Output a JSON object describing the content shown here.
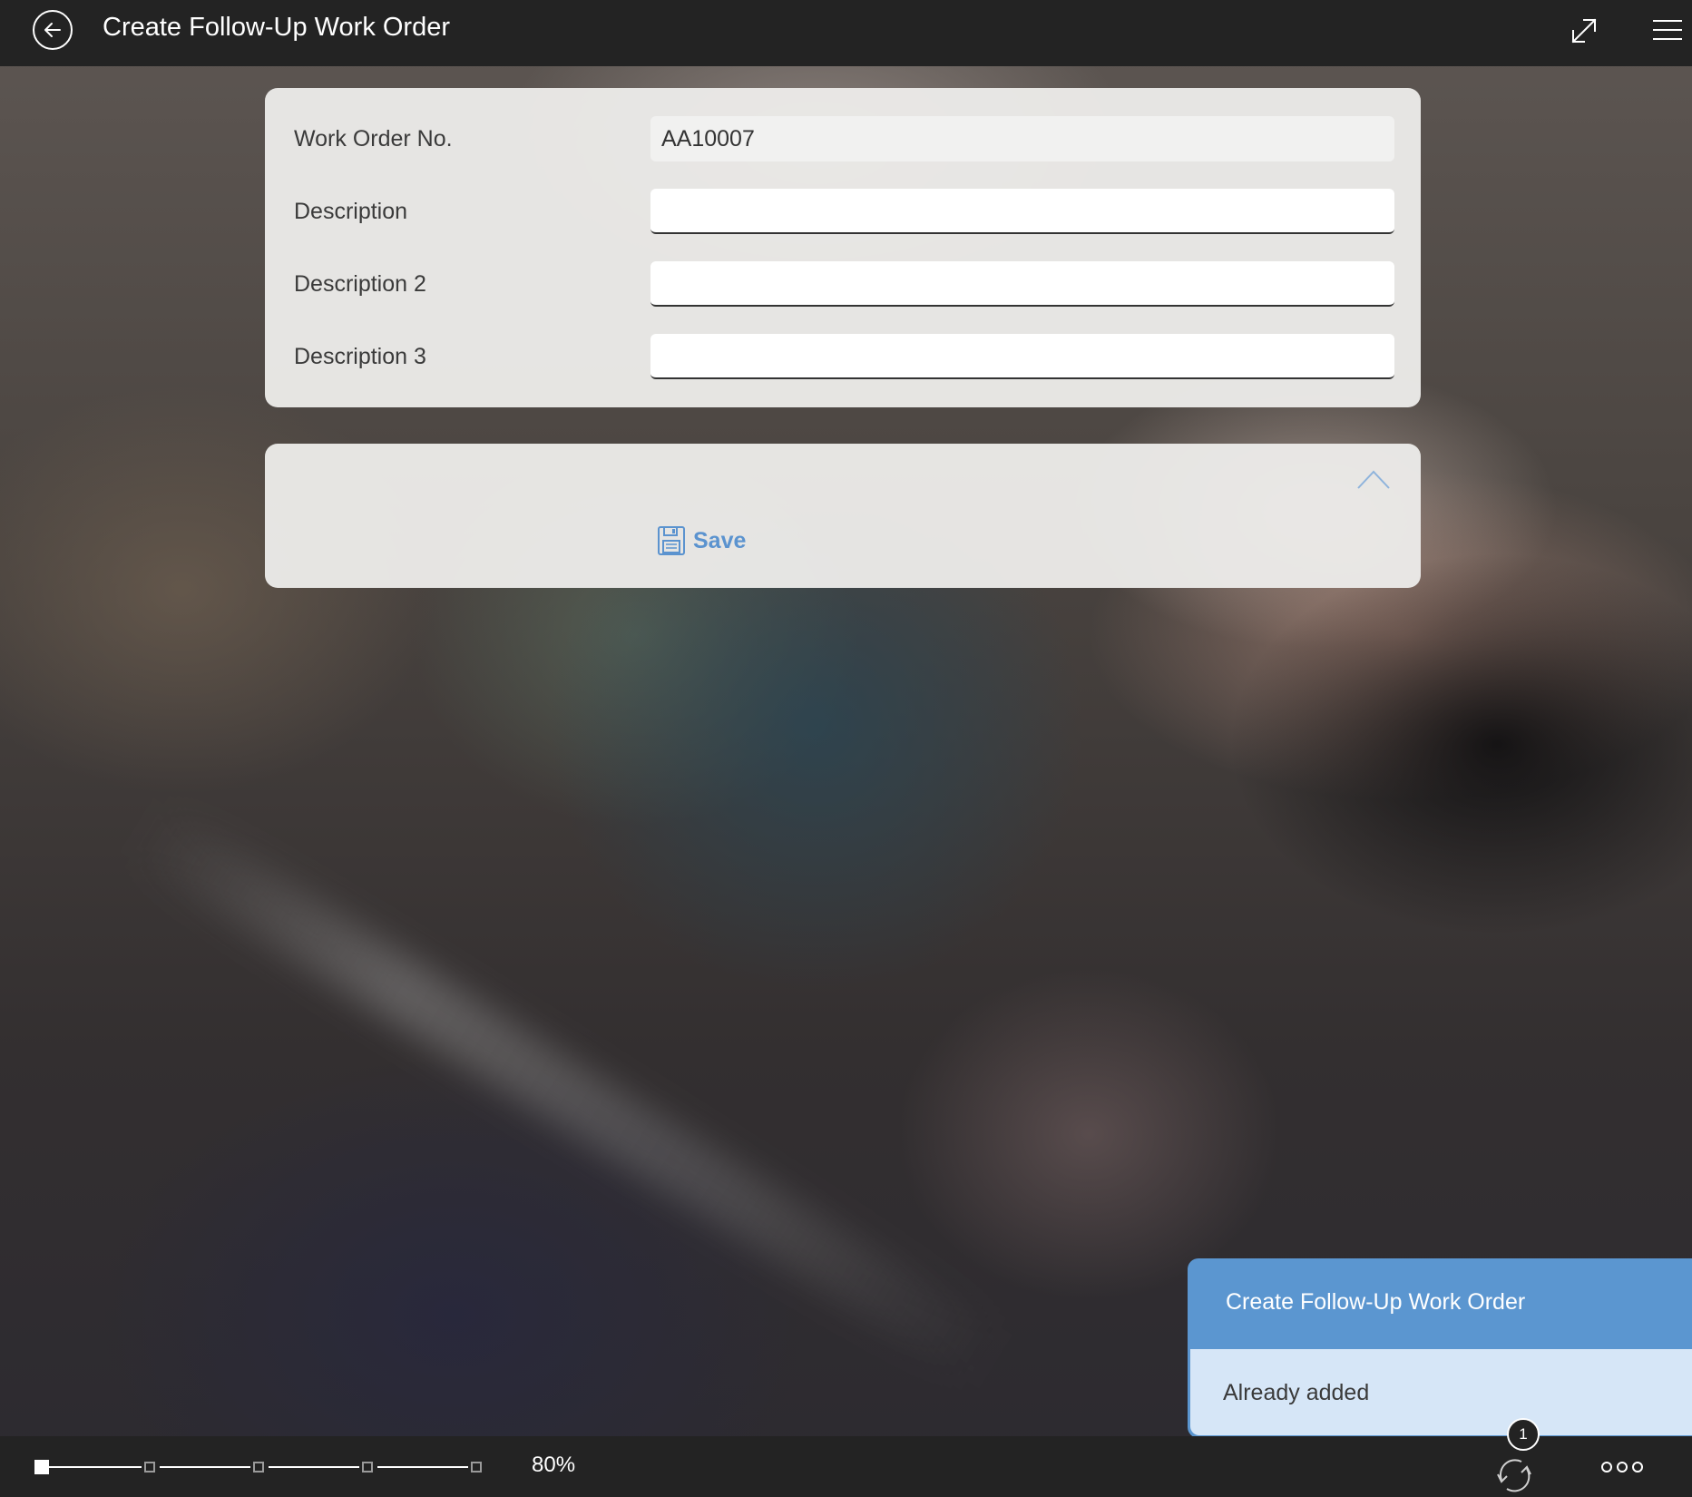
{
  "header": {
    "title": "Create Follow-Up Work Order",
    "back_icon": "arrow-left-circle-icon",
    "expand_icon": "expand-diagonal-icon",
    "menu_icon": "hamburger-menu-icon"
  },
  "form": {
    "fields": [
      {
        "label": "Work Order No.",
        "value": "AA10007",
        "readonly": true
      },
      {
        "label": "Description",
        "value": ""
      },
      {
        "label": "Description 2",
        "value": ""
      },
      {
        "label": "Description 3",
        "value": ""
      }
    ]
  },
  "actions": {
    "save_label": "Save",
    "save_icon": "floppy-disk-icon",
    "collapse_icon": "chevron-up-icon"
  },
  "notification": {
    "title": "Create Follow-Up Work Order",
    "message": "Already added"
  },
  "footer": {
    "zoom_label": "80%",
    "zoom_steps": 5,
    "zoom_selected_step": 0,
    "sync_badge": "1",
    "sync_icon": "sync-arrows-icon",
    "more_icon": "more-dots-icon"
  },
  "colors": {
    "topbar": "#232323",
    "accent": "#5b93cf",
    "toast_header": "#5b96d0",
    "toast_body": "#d6e6f7",
    "card": "#eceBe9"
  }
}
